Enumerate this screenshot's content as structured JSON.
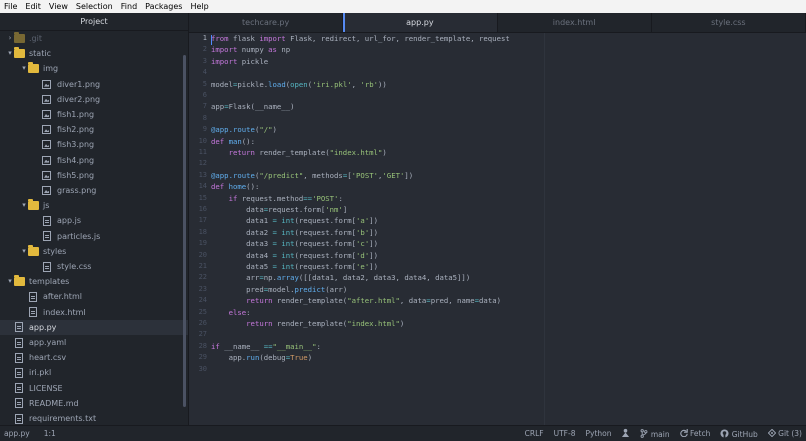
{
  "menu": [
    "File",
    "Edit",
    "View",
    "Selection",
    "Find",
    "Packages",
    "Help"
  ],
  "sidebar": {
    "title": "Project",
    "tree": [
      {
        "label": ".git",
        "kind": "folder-faded",
        "depth": 1,
        "arrow": ">"
      },
      {
        "label": "static",
        "kind": "folder",
        "depth": 1,
        "arrow": "v"
      },
      {
        "label": "img",
        "kind": "folder",
        "depth": 2,
        "arrow": "v"
      },
      {
        "label": "diver1.png",
        "kind": "image",
        "depth": 3
      },
      {
        "label": "diver2.png",
        "kind": "image",
        "depth": 3
      },
      {
        "label": "fish1.png",
        "kind": "image",
        "depth": 3
      },
      {
        "label": "fish2.png",
        "kind": "image",
        "depth": 3
      },
      {
        "label": "fish3.png",
        "kind": "image",
        "depth": 3
      },
      {
        "label": "fish4.png",
        "kind": "image",
        "depth": 3
      },
      {
        "label": "fish5.png",
        "kind": "image",
        "depth": 3
      },
      {
        "label": "grass.png",
        "kind": "image",
        "depth": 3
      },
      {
        "label": "js",
        "kind": "folder",
        "depth": 2,
        "arrow": "v"
      },
      {
        "label": "app.js",
        "kind": "file",
        "depth": 3
      },
      {
        "label": "particles.js",
        "kind": "file",
        "depth": 3
      },
      {
        "label": "styles",
        "kind": "folder",
        "depth": 2,
        "arrow": "v"
      },
      {
        "label": "style.css",
        "kind": "file",
        "depth": 3
      },
      {
        "label": "templates",
        "kind": "folder",
        "depth": 1,
        "arrow": "v"
      },
      {
        "label": "after.html",
        "kind": "file",
        "depth": 2
      },
      {
        "label": "index.html",
        "kind": "file",
        "depth": 2
      },
      {
        "label": "app.py",
        "kind": "file",
        "depth": 1,
        "selected": true
      },
      {
        "label": "app.yaml",
        "kind": "file",
        "depth": 1
      },
      {
        "label": "heart.csv",
        "kind": "file",
        "depth": 1
      },
      {
        "label": "iri.pkl",
        "kind": "file",
        "depth": 1
      },
      {
        "label": "LICENSE",
        "kind": "file",
        "depth": 1
      },
      {
        "label": "README.md",
        "kind": "file",
        "depth": 1
      },
      {
        "label": "requirements.txt",
        "kind": "file",
        "depth": 1
      }
    ]
  },
  "tabs": [
    {
      "label": "techcare.py",
      "active": false
    },
    {
      "label": "app.py",
      "active": true
    },
    {
      "label": "index.html",
      "active": false
    },
    {
      "label": "style.css",
      "active": false
    }
  ],
  "editor": {
    "current_line": 1,
    "lines": [
      [
        [
          "kw",
          "from"
        ],
        [
          "t",
          " flask "
        ],
        [
          "kw",
          "import"
        ],
        [
          "t",
          " Flask, redirect, url_for, render_template, request"
        ]
      ],
      [
        [
          "kw",
          "import"
        ],
        [
          "t",
          " numpy "
        ],
        [
          "kw",
          "as"
        ],
        [
          "t",
          " np"
        ]
      ],
      [
        [
          "kw",
          "import"
        ],
        [
          "t",
          " pickle"
        ]
      ],
      [],
      [
        [
          "t",
          "model"
        ],
        [
          "op",
          "="
        ],
        [
          "t",
          "pickle."
        ],
        [
          "fn",
          "load"
        ],
        [
          "t",
          "("
        ],
        [
          "bi",
          "open"
        ],
        [
          "t",
          "("
        ],
        [
          "str",
          "'iri.pkl'"
        ],
        [
          "t",
          ", "
        ],
        [
          "str",
          "'rb'"
        ],
        [
          "t",
          "))"
        ]
      ],
      [],
      [
        [
          "t",
          "app"
        ],
        [
          "op",
          "="
        ],
        [
          "t",
          "Flask(__name__)"
        ]
      ],
      [],
      [
        [
          "dec",
          "@app.route"
        ],
        [
          "t",
          "("
        ],
        [
          "str",
          "\"/\""
        ],
        [
          "t",
          ")"
        ]
      ],
      [
        [
          "kw",
          "def"
        ],
        [
          "t",
          " "
        ],
        [
          "fn",
          "man"
        ],
        [
          "t",
          "():"
        ]
      ],
      [
        [
          "t",
          "    "
        ],
        [
          "kw",
          "return"
        ],
        [
          "t",
          " render_template("
        ],
        [
          "str",
          "\"index.html\""
        ],
        [
          "t",
          ")"
        ]
      ],
      [],
      [
        [
          "dec",
          "@app.route"
        ],
        [
          "t",
          "("
        ],
        [
          "str",
          "\"/predict\""
        ],
        [
          "t",
          ", methods"
        ],
        [
          "op",
          "="
        ],
        [
          "t",
          "["
        ],
        [
          "str",
          "'POST'"
        ],
        [
          "t",
          ","
        ],
        [
          "str",
          "'GET'"
        ],
        [
          "t",
          "])"
        ]
      ],
      [
        [
          "kw",
          "def"
        ],
        [
          "t",
          " "
        ],
        [
          "fn",
          "home"
        ],
        [
          "t",
          "():"
        ]
      ],
      [
        [
          "t",
          "    "
        ],
        [
          "kw",
          "if"
        ],
        [
          "t",
          " request.method"
        ],
        [
          "op",
          "=="
        ],
        [
          "str",
          "'POST'"
        ],
        [
          "t",
          ":"
        ]
      ],
      [
        [
          "t",
          "        data"
        ],
        [
          "op",
          "="
        ],
        [
          "t",
          "request.form["
        ],
        [
          "str",
          "'nm'"
        ],
        [
          "t",
          "]"
        ]
      ],
      [
        [
          "t",
          "        data1 "
        ],
        [
          "op",
          "="
        ],
        [
          "t",
          " "
        ],
        [
          "bi",
          "int"
        ],
        [
          "t",
          "(request.form["
        ],
        [
          "str",
          "'a'"
        ],
        [
          "t",
          "])"
        ]
      ],
      [
        [
          "t",
          "        data2 "
        ],
        [
          "op",
          "="
        ],
        [
          "t",
          " "
        ],
        [
          "bi",
          "int"
        ],
        [
          "t",
          "(request.form["
        ],
        [
          "str",
          "'b'"
        ],
        [
          "t",
          "])"
        ]
      ],
      [
        [
          "t",
          "        data3 "
        ],
        [
          "op",
          "="
        ],
        [
          "t",
          " "
        ],
        [
          "bi",
          "int"
        ],
        [
          "t",
          "(request.form["
        ],
        [
          "str",
          "'c'"
        ],
        [
          "t",
          "])"
        ]
      ],
      [
        [
          "t",
          "        data4 "
        ],
        [
          "op",
          "="
        ],
        [
          "t",
          " "
        ],
        [
          "bi",
          "int"
        ],
        [
          "t",
          "(request.form["
        ],
        [
          "str",
          "'d'"
        ],
        [
          "t",
          "])"
        ]
      ],
      [
        [
          "t",
          "        data5 "
        ],
        [
          "op",
          "="
        ],
        [
          "t",
          " "
        ],
        [
          "bi",
          "int"
        ],
        [
          "t",
          "(request.form["
        ],
        [
          "str",
          "'e'"
        ],
        [
          "t",
          "])"
        ]
      ],
      [
        [
          "t",
          "        arr"
        ],
        [
          "op",
          "="
        ],
        [
          "t",
          "np."
        ],
        [
          "fn",
          "array"
        ],
        [
          "t",
          "([[data1, data2, data3, data4, data5]])"
        ]
      ],
      [
        [
          "t",
          "        pred"
        ],
        [
          "op",
          "="
        ],
        [
          "t",
          "model."
        ],
        [
          "fn",
          "predict"
        ],
        [
          "t",
          "(arr)"
        ]
      ],
      [
        [
          "t",
          "        "
        ],
        [
          "kw",
          "return"
        ],
        [
          "t",
          " render_template("
        ],
        [
          "str",
          "\"after.html\""
        ],
        [
          "t",
          ", data"
        ],
        [
          "op",
          "="
        ],
        [
          "t",
          "pred, name"
        ],
        [
          "op",
          "="
        ],
        [
          "t",
          "data)"
        ]
      ],
      [
        [
          "t",
          "    "
        ],
        [
          "kw",
          "else"
        ],
        [
          "t",
          ":"
        ]
      ],
      [
        [
          "t",
          "        "
        ],
        [
          "kw",
          "return"
        ],
        [
          "t",
          " render_template("
        ],
        [
          "str",
          "\"index.html\""
        ],
        [
          "t",
          ")"
        ]
      ],
      [],
      [
        [
          "kw",
          "if"
        ],
        [
          "t",
          " __name__ "
        ],
        [
          "op",
          "=="
        ],
        [
          "str",
          "\"__main__\""
        ],
        [
          "t",
          ":"
        ]
      ],
      [
        [
          "t",
          "    app."
        ],
        [
          "fn",
          "run"
        ],
        [
          "t",
          "(debug"
        ],
        [
          "op",
          "="
        ],
        [
          "num",
          "True"
        ],
        [
          "t",
          ")"
        ]
      ],
      []
    ]
  },
  "status": {
    "file": "app.py",
    "position": "1:1",
    "line_ending": "CRLF",
    "encoding": "UTF-8",
    "grammar": "Python",
    "branch": "main",
    "fetch": "Fetch",
    "github": "GitHub",
    "git": "Git (3)"
  }
}
